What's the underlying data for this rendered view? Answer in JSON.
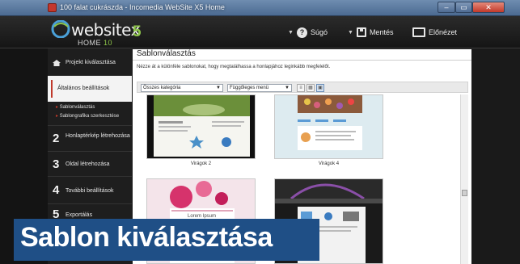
{
  "window": {
    "title": "100 falat cukrászda - Incomedia WebSite X5 Home",
    "controls": {
      "minimize": "–",
      "maximize": "▭",
      "close": "✕"
    }
  },
  "header": {
    "logo_word": "websitex",
    "logo_sub": "HOME",
    "logo_sub_num": "10",
    "logo_suffix": "5",
    "buttons": [
      {
        "label": "Súgó",
        "icon": "help-icon"
      },
      {
        "label": "Mentés",
        "icon": "save-icon"
      },
      {
        "label": "Előnézet",
        "icon": "preview-icon"
      }
    ]
  },
  "sidebar": {
    "items": [
      {
        "num": "",
        "label": "Projekt kiválasztása",
        "icon": "home-icon"
      },
      {
        "num": "1",
        "label": "Általános beállítások"
      },
      {
        "num": "2",
        "label": "Honlaptérkép létrehozása"
      },
      {
        "num": "3",
        "label": "Oldal létrehozása"
      },
      {
        "num": "4",
        "label": "További beállítások"
      },
      {
        "num": "5",
        "label": "Exportálás"
      }
    ],
    "subitems": [
      "Sablonválasztás",
      "Sablongrafika szerkesztése"
    ]
  },
  "content": {
    "title": "Sablonválasztás",
    "description": "Nézze át a különféle sablonokat, hogy megtalálhassa a honlapjához leginkább megfelelőt.",
    "category_select": "Összes kategória",
    "menu_select": "Függőleges menü",
    "thumbnails": [
      {
        "caption": "Virágok 2"
      },
      {
        "caption": "Virágok 4"
      },
      {
        "caption": "Lorem Ipsum"
      },
      {
        "caption": ""
      }
    ]
  },
  "overlay_caption": "Sablon kiválasztása",
  "colors": {
    "accent_red": "#c0392b",
    "accent_green": "#8fc64b",
    "caption_blue": "#1f4f86"
  }
}
